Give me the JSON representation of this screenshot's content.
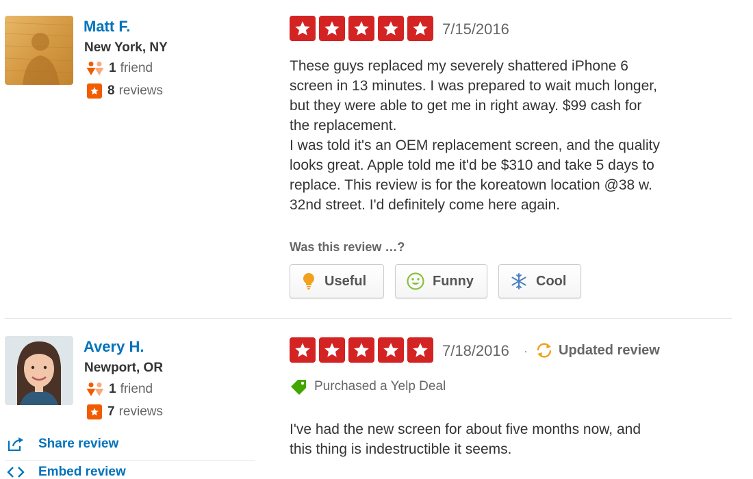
{
  "reviews": [
    {
      "user": {
        "name": "Matt F.",
        "location": "New York, NY",
        "friends_count": "1",
        "friends_label": "friend",
        "reviews_count": "8",
        "reviews_label": "reviews"
      },
      "rating": 5,
      "date": "7/15/2016",
      "text": "These guys replaced my severely shattered iPhone 6\nscreen in 13 minutes.  I was prepared to wait much longer,\nbut they were able to get me in right away.  $99 cash for\nthe replacement.\nI was told it's an OEM replacement screen, and the quality\nlooks great.  Apple told me it'd be $310 and take 5 days to\nreplace.  This review is for the koreatown location @38 w.\n32nd street.  I'd definitely come here again.",
      "vote_prompt": "Was this review …?",
      "votes": {
        "useful": "Useful",
        "funny": "Funny",
        "cool": "Cool"
      }
    },
    {
      "user": {
        "name": "Avery H.",
        "location": "Newport, OR",
        "friends_count": "1",
        "friends_label": "friend",
        "reviews_count": "7",
        "reviews_label": "reviews"
      },
      "rating": 5,
      "date": "7/18/2016",
      "separator": "·",
      "updated_label": "Updated review",
      "deal_label": "Purchased a Yelp Deal",
      "text": "I've had the new screen for about five months now, and\nthis thing is indestructible it seems."
    }
  ],
  "side_actions": {
    "share": "Share review",
    "embed": "Embed review"
  },
  "colors": {
    "star_red": "#d32323",
    "link_blue": "#0073bb",
    "review_orange": "#f15c00",
    "updated_orange": "#f2a11e",
    "deal_green": "#41a700"
  }
}
